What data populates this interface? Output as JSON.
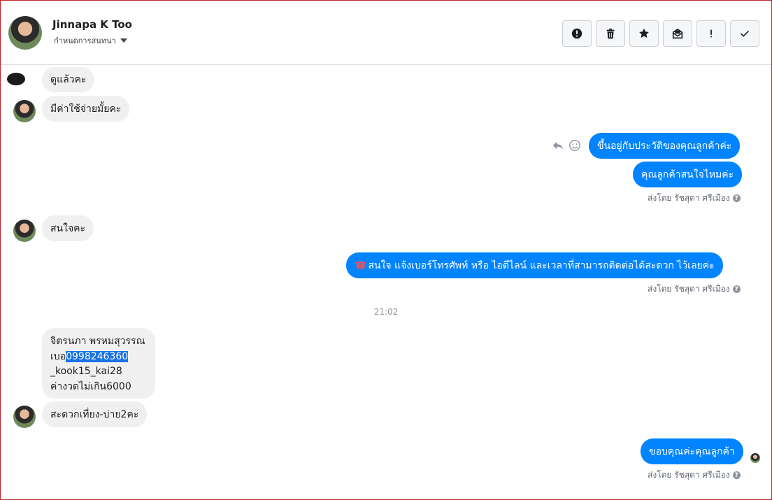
{
  "header": {
    "contact_name": "Jinnapa K Too",
    "assign_label": "กำหนดการสนทนา",
    "toolbar": [
      {
        "name": "report-button",
        "icon": "exclamation-circle-icon"
      },
      {
        "name": "delete-button",
        "icon": "trash-icon"
      },
      {
        "name": "star-button",
        "icon": "star-icon"
      },
      {
        "name": "mark-unread-button",
        "icon": "envelope-open-icon"
      },
      {
        "name": "spam-button",
        "icon": "exclamation-icon"
      },
      {
        "name": "done-button",
        "icon": "check-icon"
      }
    ]
  },
  "messages": {
    "m1": "ดูแล้วคะ",
    "m2": "มีค่าใช้จ่ายมั้ยคะ",
    "m3": "ขึ้นอยู่กับประวัติของคุณลูกค้าค่ะ",
    "m4": "คุณลูกค้าสนใจไหมค่ะ",
    "m5": "สนใจคะ",
    "m6": "สนใจ แจ้งเบอร์โทรศัพท์ หรือ ไอดีไลน์ และเวลาที่สามารถติดต่อได้สะดวก ไว้เลยค่ะ",
    "m6_icon": "☎",
    "time": "21:02",
    "m7_line1": "จิตรนภา พรหมสุวรรณ",
    "m7_line2_prefix": "เบอ",
    "m7_line2_phone": "0998246360",
    "m7_line3": "_kook15_kai28",
    "m7_line4": "ค่างวดไม่เกิน6000",
    "m8": "สะดวกเที่ยง-บ่าย2คะ",
    "m9": "ขอบคุณค่ะคุณลูกค้า"
  },
  "sent_by": "ส่งโดย รัชสุดา ศรีเมือง",
  "sent_by_help": "?",
  "colors": {
    "outgoing": "#0084ff",
    "incoming": "#f0f0f0"
  }
}
